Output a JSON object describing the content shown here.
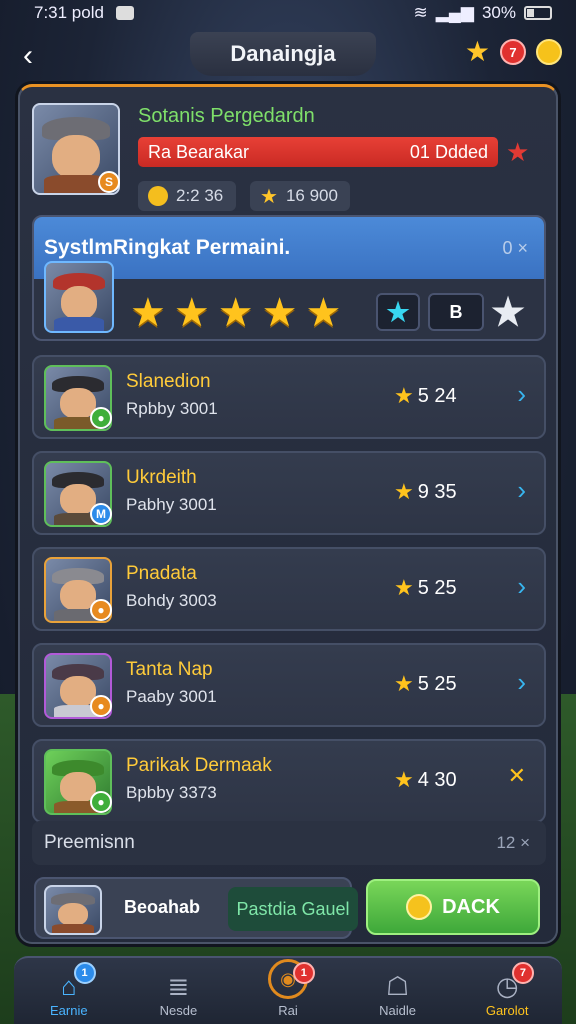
{
  "status": {
    "time": "7:31 pold",
    "battery": "30%"
  },
  "header": {
    "title": "Danaingja",
    "badge_count": "7"
  },
  "profile": {
    "name": "Sotanis Pergedardn",
    "progress_label": "Ra Bearakar",
    "progress_value": "01 Ddded",
    "coins": "2:2 36",
    "stars": "16 900",
    "badge": "S"
  },
  "ranking": {
    "title": "SystlmRingkat Permaini.",
    "count": "0 ×",
    "stars_rating": 5,
    "btn_b": "B"
  },
  "players": [
    {
      "name": "Slanedion",
      "sub": "Rpbby 3001",
      "score": "5 24",
      "badge": "●"
    },
    {
      "name": "Ukrdeith",
      "sub": "Pabhy 3001",
      "score": "9 35",
      "badge": "M"
    },
    {
      "name": "Pnadata",
      "sub": "Bohdy 3003",
      "score": "5 25",
      "badge": "●"
    },
    {
      "name": "Tanta Nap",
      "sub": "Paaby 3001",
      "score": "5 25",
      "badge": "●"
    },
    {
      "name": "Parikak Dermaak",
      "sub": "Bpbby 3373",
      "score": "4 30",
      "badge": "●"
    }
  ],
  "premium": {
    "label": "Preemisnn",
    "count": "12 ×"
  },
  "bottom": {
    "name": "Beoahab",
    "green_label": "Pastdia Gauel",
    "back_label": "DACK"
  },
  "nav": [
    {
      "label": "Earnie",
      "badge": "1"
    },
    {
      "label": "Nesde",
      "badge": ""
    },
    {
      "label": "Rai",
      "badge": "1"
    },
    {
      "label": "Naidle",
      "badge": ""
    },
    {
      "label": "Garolot",
      "badge": "7"
    }
  ]
}
